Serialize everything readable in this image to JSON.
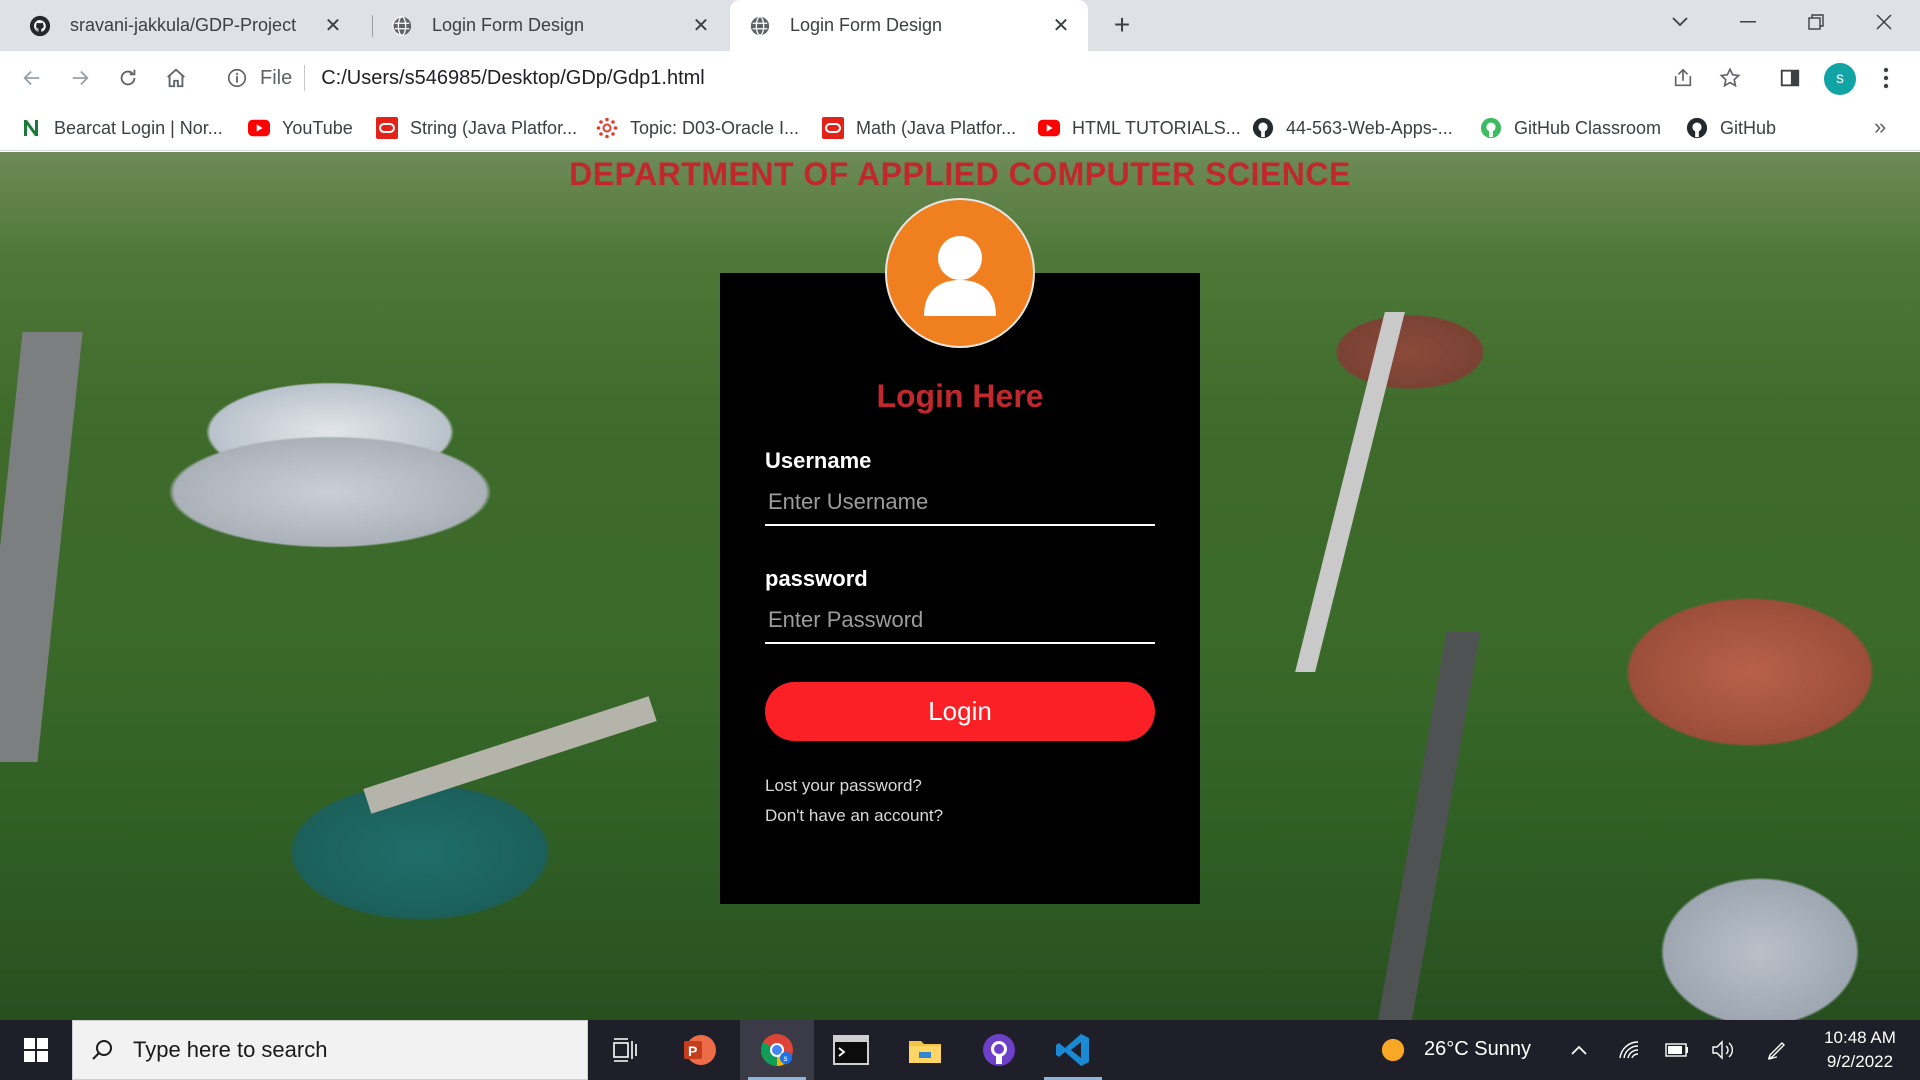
{
  "tabs": [
    {
      "title": "sravani-jakkula/GDP-Project",
      "icon": "github-icon",
      "active": false
    },
    {
      "title": "Login Form Design",
      "icon": "globe-icon",
      "active": false
    },
    {
      "title": "Login Form Design",
      "icon": "globe-icon",
      "active": true
    }
  ],
  "address_bar": {
    "scheme_label": "File",
    "url": "C:/Users/s546985/Desktop/GDp/Gdp1.html"
  },
  "profile": {
    "initial": "s",
    "color": "#10a4a4"
  },
  "bookmarks": [
    {
      "label": "Bearcat Login | Nor...",
      "icon": "northwest-n-icon"
    },
    {
      "label": "YouTube",
      "icon": "youtube-icon"
    },
    {
      "label": "String (Java Platfor...",
      "icon": "oracle-icon"
    },
    {
      "label": "Topic: D03-Oracle I...",
      "icon": "canvas-icon"
    },
    {
      "label": "Math (Java Platfor...",
      "icon": "oracle-icon"
    },
    {
      "label": "HTML TUTORIALS...",
      "icon": "youtube-icon"
    },
    {
      "label": "44-563-Web-Apps-...",
      "icon": "github-icon"
    },
    {
      "label": "GitHub Classroom",
      "icon": "github-classroom-icon"
    },
    {
      "label": "GitHub",
      "icon": "github-icon"
    }
  ],
  "page": {
    "department_title": "DEPARTMENT OF APPLIED COMPUTER SCIENCE",
    "login": {
      "heading": "Login Here",
      "username_label": "Username",
      "username_placeholder": "Enter Username",
      "username_value": "",
      "password_label": "password",
      "password_placeholder": "Enter Password",
      "password_value": "",
      "button_label": "Login",
      "lost_password_link": "Lost your password?",
      "signup_link": "Don't have an account?"
    }
  },
  "colors": {
    "title_red": "#c0282d",
    "button_red": "#fb1f26",
    "avatar_orange": "#f07f1f",
    "panel_black": "#000000"
  },
  "taskbar": {
    "search_placeholder": "Type here to search",
    "apps": [
      "task-view-icon",
      "powerpoint-icon",
      "chrome-icon",
      "terminal-icon",
      "file-explorer-icon",
      "github-desktop-icon",
      "vscode-icon"
    ],
    "weather": "26°C  Sunny",
    "time": "10:48 AM",
    "date": "9/2/2022"
  }
}
